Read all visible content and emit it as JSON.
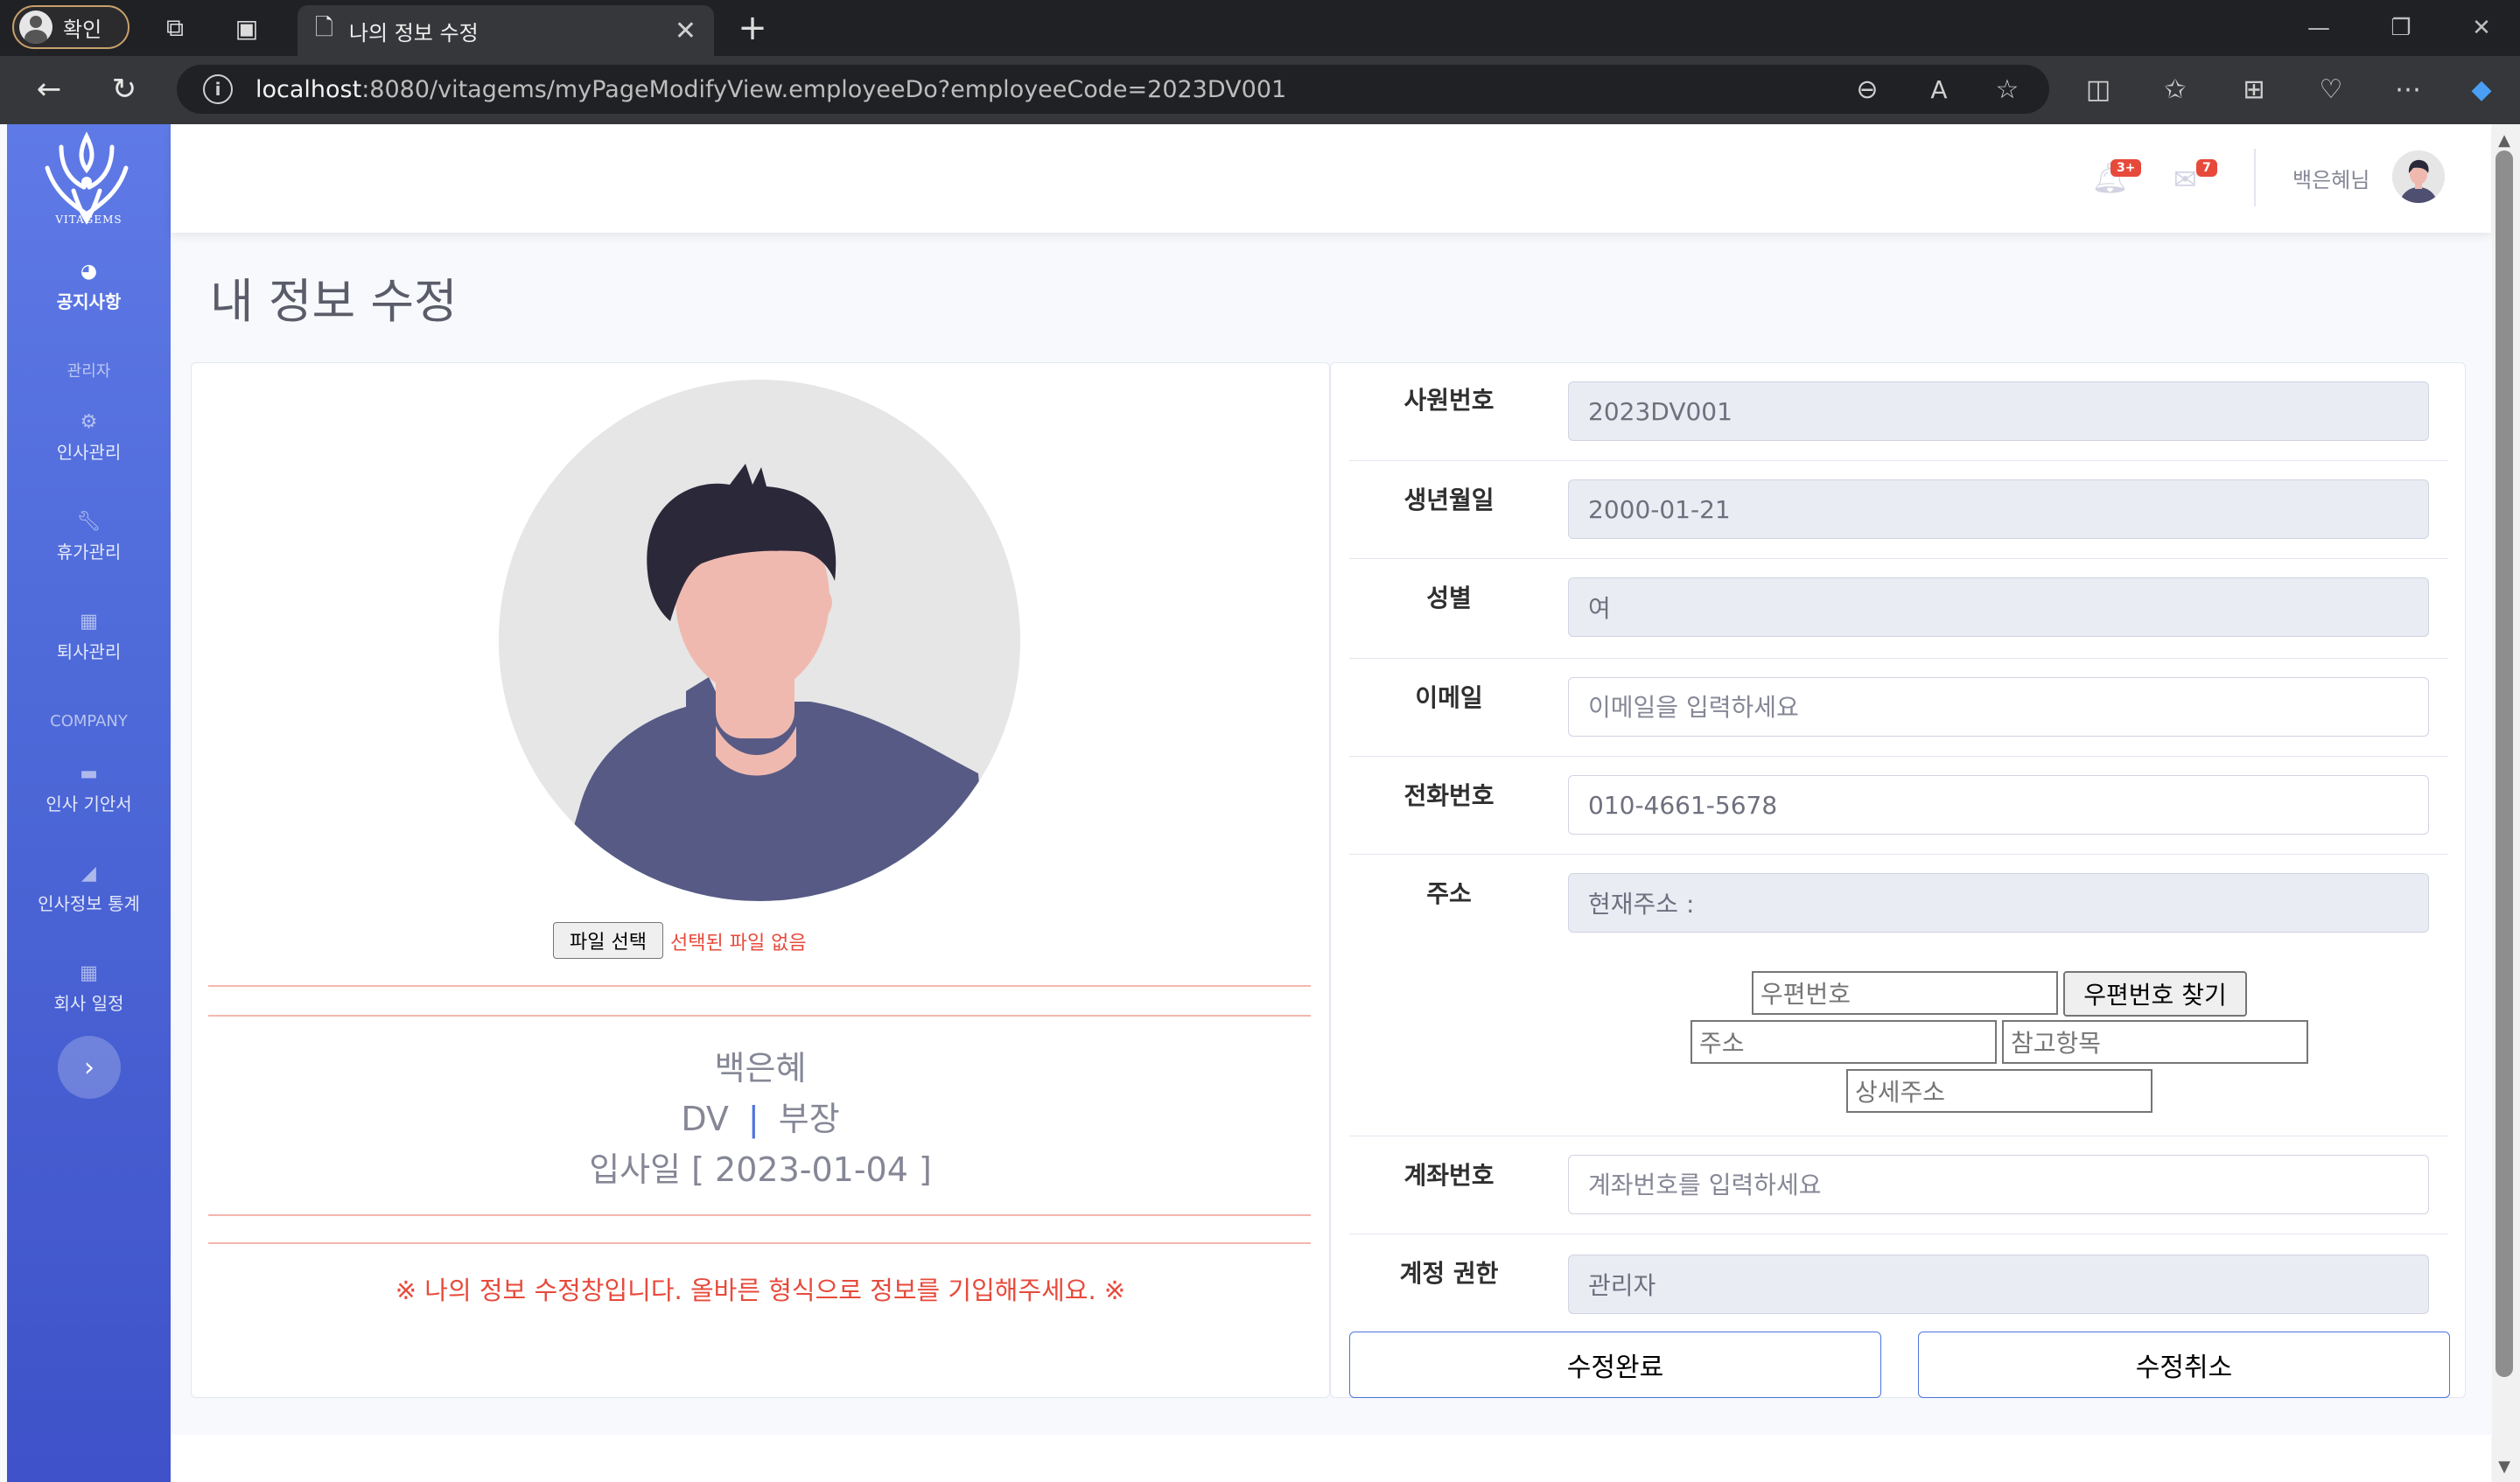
{
  "browser": {
    "profile_label": "확인",
    "tab_title": "나의 정보 수정",
    "url_host": "localhost",
    "url_rest": ":8080/vitagems/myPageModifyView.employeeDo?employeeCode=2023DV001"
  },
  "sidebar": {
    "logo_text": "VITAGEMS",
    "items": [
      {
        "label": "공지사항",
        "icon": "dashboard-icon"
      },
      {
        "label": "인사관리",
        "icon": "gear-icon"
      },
      {
        "label": "휴가관리",
        "icon": "wrench-icon"
      },
      {
        "label": "퇴사관리",
        "icon": "table-icon"
      },
      {
        "label": "인사 기안서",
        "icon": "folder-icon"
      },
      {
        "label": "인사정보 통계",
        "icon": "chart-area-icon"
      },
      {
        "label": "회사 일정",
        "icon": "table-icon"
      }
    ],
    "headings": {
      "admin": "관리자",
      "company": "COMPANY"
    }
  },
  "topbar": {
    "alerts_badge": "3+",
    "messages_badge": "7",
    "user_name": "백은혜님"
  },
  "page": {
    "title": "내 정보 수정"
  },
  "profile": {
    "file_button": "파일 선택",
    "file_status": "선택된 파일 없음",
    "name": "백은혜",
    "department": "DV",
    "separator": "|",
    "position": "부장",
    "join_label": "입사일 [ 2023-01-04 ]",
    "notice": "※ 나의 정보 수정창입니다. 올바른 형식으로 정보를 기입해주세요. ※"
  },
  "form": {
    "employee_code": {
      "label": "사원번호",
      "value": "2023DV001"
    },
    "birth": {
      "label": "생년월일",
      "value": "2000-01-21"
    },
    "gender": {
      "label": "성별",
      "value": "여"
    },
    "email": {
      "label": "이메일",
      "placeholder": "이메일을 입력하세요"
    },
    "phone": {
      "label": "전화번호",
      "value": "010-4661-5678"
    },
    "address": {
      "label": "주소",
      "current": "현재주소 :",
      "postcode_placeholder": "우편번호",
      "find_button": "우편번호 찾기",
      "addr_placeholder": "주소",
      "extra_placeholder": "참고항목",
      "detail_placeholder": "상세주소"
    },
    "account": {
      "label": "계좌번호",
      "placeholder": "계좌번호를 입력하세요"
    },
    "role": {
      "label": "계정 권한",
      "value": "관리자"
    },
    "submit_button": "수정완료",
    "cancel_button": "수정취소"
  }
}
